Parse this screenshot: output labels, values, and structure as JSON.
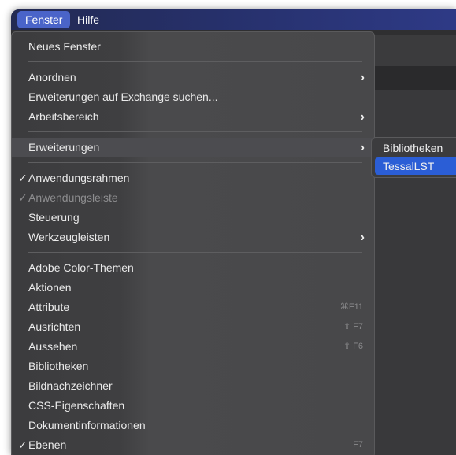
{
  "menubar": {
    "items": [
      "Fenster",
      "Hilfe"
    ]
  },
  "menu": {
    "neues_fenster": "Neues Fenster",
    "anordnen": "Anordnen",
    "exchange": "Erweiterungen auf Exchange suchen...",
    "arbeitsbereich": "Arbeitsbereich",
    "erweiterungen": "Erweiterungen",
    "anwendungsrahmen": "Anwendungsrahmen",
    "anwendungsleiste": "Anwendungsleiste",
    "steuerung": "Steuerung",
    "werkzeugleisten": "Werkzeugleisten",
    "adobe_color": "Adobe Color-Themen",
    "aktionen": "Aktionen",
    "attribute": "Attribute",
    "attribute_shortcut": "⌘F11",
    "ausrichten": "Ausrichten",
    "ausrichten_shortcut": "⇧ F7",
    "aussehen": "Aussehen",
    "aussehen_shortcut": "⇧ F6",
    "bibliotheken": "Bibliotheken",
    "bildnachzeichner": "Bildnachzeichner",
    "css": "CSS-Eigenschaften",
    "dokumentinfo": "Dokumentinformationen",
    "ebenen": "Ebenen",
    "ebenen_shortcut": "F7",
    "check": "✓",
    "arrow": "›"
  },
  "submenu": {
    "items": [
      "Bibliotheken",
      "TessalLST"
    ]
  }
}
